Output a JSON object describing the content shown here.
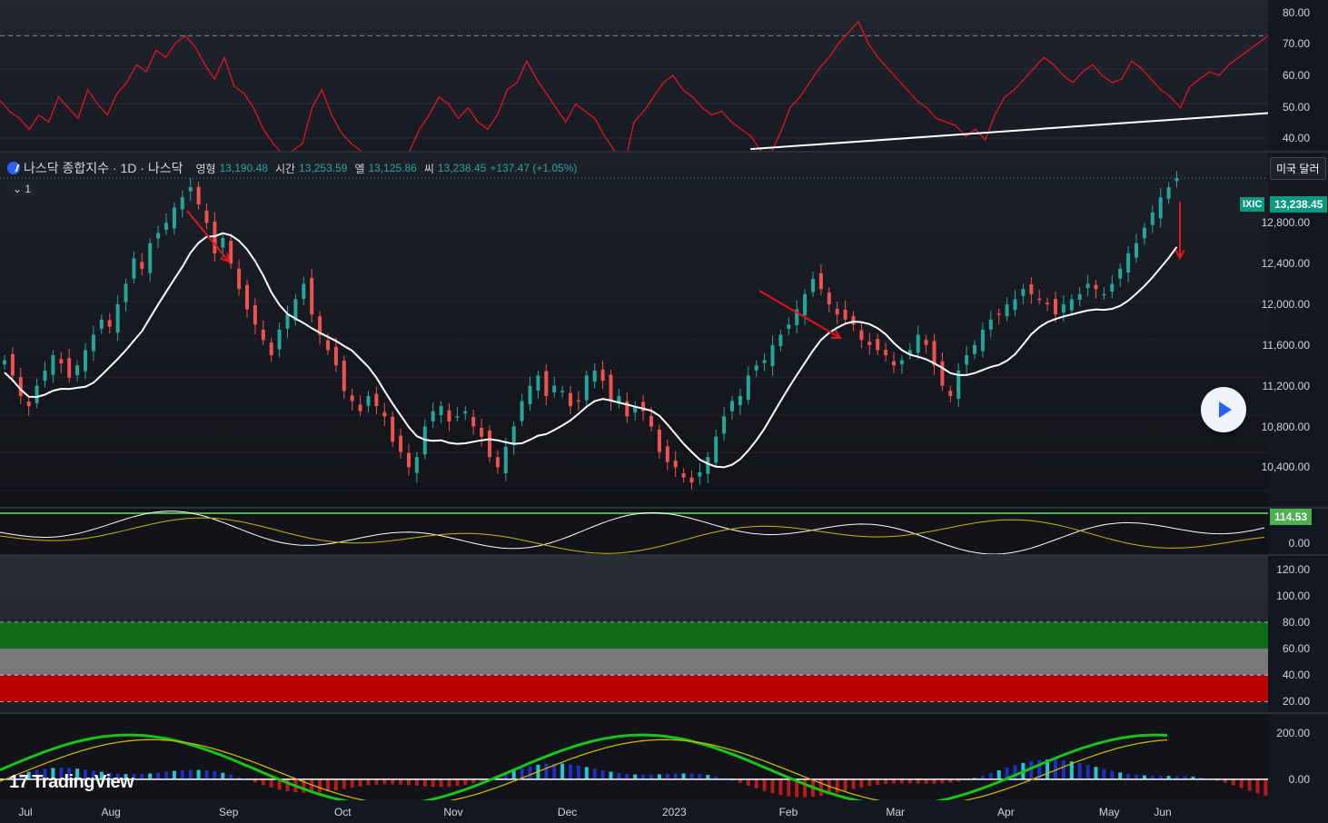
{
  "legend": {
    "symbol_name": "나스닥 종합지수 · 1D · 나스닥",
    "open_label": "영형",
    "open_value": "13,190.48",
    "high_label": "시간",
    "high_value": "13,253.59",
    "low_label": "엘",
    "low_value": "13,125.86",
    "close_label": "씨",
    "close_value": "13,238.45",
    "change": "+137.47 (+1.05%)",
    "collapse_label": "1"
  },
  "currency_button": "미국 달러",
  "price_tag": {
    "symbol": "IXIC",
    "value": "13,238.45"
  },
  "osc_tag": "114.53",
  "brand": "TradingView",
  "colors": {
    "up": "#26a69a",
    "down": "#ef5350",
    "rsi": "#e2151b",
    "sma": "#ffffff",
    "band_green": "#0f6b1a",
    "band_gray": "#787878",
    "band_red": "#b80000"
  },
  "icons": {
    "play": "play-icon",
    "logo": "nasdaq-logo-icon"
  },
  "chart_data": [
    {
      "type": "line",
      "name": "rsi-pane",
      "y_ticks": [
        "80.00",
        "70.00",
        "60.00",
        "50.00",
        "40.00"
      ],
      "ylim": [
        38,
        80
      ],
      "series": [
        {
          "values": [
            52,
            49,
            47,
            44,
            48,
            46,
            53,
            50,
            47,
            55,
            51,
            48,
            54,
            57,
            62,
            60,
            66,
            64,
            68,
            70,
            67,
            62,
            58,
            64,
            56,
            54,
            50,
            44,
            40,
            37,
            38,
            40,
            50,
            55,
            48,
            43,
            40,
            38,
            34,
            35,
            33,
            32,
            38,
            44,
            48,
            53,
            51,
            47,
            50,
            46,
            44,
            48,
            55,
            57,
            63,
            58,
            54,
            50,
            46,
            51,
            49,
            47,
            42,
            38,
            34,
            46,
            49,
            53,
            57,
            59,
            55,
            53,
            50,
            48,
            49,
            46,
            44,
            42,
            38,
            37,
            43,
            50,
            53,
            57,
            61,
            64,
            68,
            71,
            74,
            68,
            64,
            61,
            58,
            55,
            52,
            50,
            47,
            46,
            45,
            42,
            44,
            41,
            48,
            53,
            55,
            58,
            61,
            64,
            62,
            59,
            57,
            60,
            62,
            59,
            57,
            58,
            63,
            61,
            58,
            55,
            53,
            50,
            56,
            58,
            60,
            59,
            62,
            64,
            66,
            68,
            70,
            69,
            71,
            72,
            73,
            74
          ]
        }
      ],
      "reference_line": 70,
      "trendline": [
        [
          108,
          39.5
        ],
        [
          156,
          48
        ]
      ]
    },
    {
      "type": "candlestick",
      "name": "price-pane",
      "y_ticks": [
        "12,800.00",
        "12,400.00",
        "12,000.00",
        "11,600.00",
        "11,200.00",
        "10,800.00",
        "10,400.00"
      ],
      "ylim": [
        10100,
        13400
      ],
      "x_labels": [
        "Jul",
        "Aug",
        "Sep",
        "Oct",
        "Nov",
        "Dec",
        "2023",
        "Feb",
        "Mar",
        "Apr",
        "May",
        "Jun"
      ],
      "close": [
        11450,
        11300,
        11100,
        11000,
        11200,
        11350,
        11500,
        11420,
        11280,
        11400,
        11550,
        11700,
        11850,
        11780,
        12000,
        12200,
        12450,
        12350,
        12600,
        12700,
        12800,
        12950,
        13050,
        13150,
        12980,
        12800,
        12500,
        12650,
        12400,
        12150,
        11950,
        11800,
        11650,
        11500,
        11750,
        11900,
        12050,
        12200,
        11900,
        11700,
        11550,
        11400,
        11150,
        11050,
        10950,
        11100,
        11000,
        10900,
        10650,
        10550,
        10400,
        10500,
        10800,
        10950,
        11000,
        10850,
        10900,
        10950,
        10800,
        10700,
        10500,
        10400,
        10600,
        10800,
        11050,
        11200,
        11300,
        11100,
        11200,
        11150,
        11000,
        11050,
        11300,
        11350,
        11250,
        11050,
        11100,
        10900,
        11000,
        10950,
        10800,
        10550,
        10450,
        10400,
        10300,
        10250,
        10350,
        10500,
        10700,
        10900,
        11050,
        11100,
        11300,
        11400,
        11450,
        11600,
        11700,
        11800,
        11950,
        12100,
        12250,
        12150,
        12000,
        11900,
        11850,
        11800,
        11650,
        11600,
        11550,
        11500,
        11400,
        11450,
        11550,
        11700,
        11600,
        11400,
        11200,
        11100,
        11350,
        11500,
        11600,
        11750,
        11850,
        11900,
        12000,
        12050,
        12150,
        12100,
        12050,
        12000,
        11900,
        12000,
        12050,
        12100,
        12200,
        12150,
        12100,
        12200,
        12350,
        12500,
        12600,
        12750,
        12900,
        13050,
        13150,
        13238
      ]
    },
    {
      "type": "line",
      "name": "oscillator-pane",
      "y_ticks": [
        "114.53",
        "0.00"
      ],
      "ylim": [
        0,
        130
      ]
    },
    {
      "type": "area",
      "name": "band-pane",
      "y_ticks": [
        "120.00",
        "100.00",
        "80.00",
        "60.00",
        "40.00",
        "20.00"
      ],
      "ylim": [
        12,
        130
      ],
      "bands": [
        {
          "from": 60,
          "to": 80,
          "color": "green"
        },
        {
          "from": 40,
          "to": 60,
          "color": "gray"
        },
        {
          "from": 20,
          "to": 40,
          "color": "red"
        }
      ]
    },
    {
      "type": "bar",
      "name": "macd-pane",
      "y_ticks": [
        "200.00",
        "0.00"
      ],
      "ylim": [
        -90,
        280
      ]
    }
  ]
}
